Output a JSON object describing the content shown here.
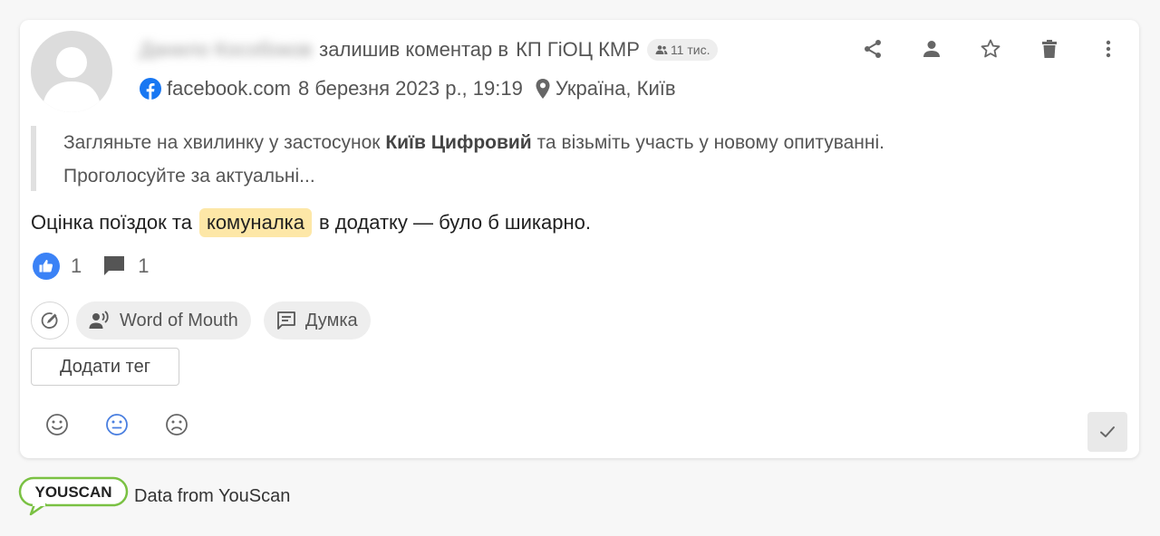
{
  "post": {
    "author_name": "Данило Кособоков",
    "action_text": "залишив коментар в",
    "source_name": "КП ГіОЦ КМР",
    "audience": "11 тис.",
    "site": "facebook.com",
    "date": "8 березня 2023 р., 19:19",
    "location": "Україна, Київ",
    "quote_before": "Загляньте на хвилинку у застосунок ",
    "quote_bold": "Київ Цифровий",
    "quote_after": " та візьміть участь у новому опитуванні.",
    "quote_line2": "Проголосуйте за актуальні...",
    "text_before": "Оцінка поїздок та",
    "text_highlight": "комуналка",
    "text_after": "в додатку — було б шикарно.",
    "likes": "1",
    "comments": "1"
  },
  "top_actions": [
    {
      "icon": "share-icon"
    },
    {
      "icon": "person-icon"
    },
    {
      "icon": "star-icon"
    },
    {
      "icon": "trash-icon"
    },
    {
      "icon": "more-vertical-icon"
    }
  ],
  "tags": [
    {
      "label": "Word of Mouth",
      "icon": "speaker-person-icon"
    },
    {
      "label": "Думка",
      "icon": "comment-text-icon"
    }
  ],
  "add_tag_label": "Додати тег",
  "sentiment": {
    "options": [
      "positive",
      "neutral",
      "negative"
    ],
    "selected": "neutral",
    "active_color": "#4a7fe0"
  },
  "footer": {
    "logo_text": "YOUSCAN",
    "text": "Data from YouScan"
  },
  "colors": {
    "highlight": "#fde7a7",
    "like": "#3b82f6",
    "facebook": "#1877f2",
    "logo_green": "#7ac143"
  }
}
